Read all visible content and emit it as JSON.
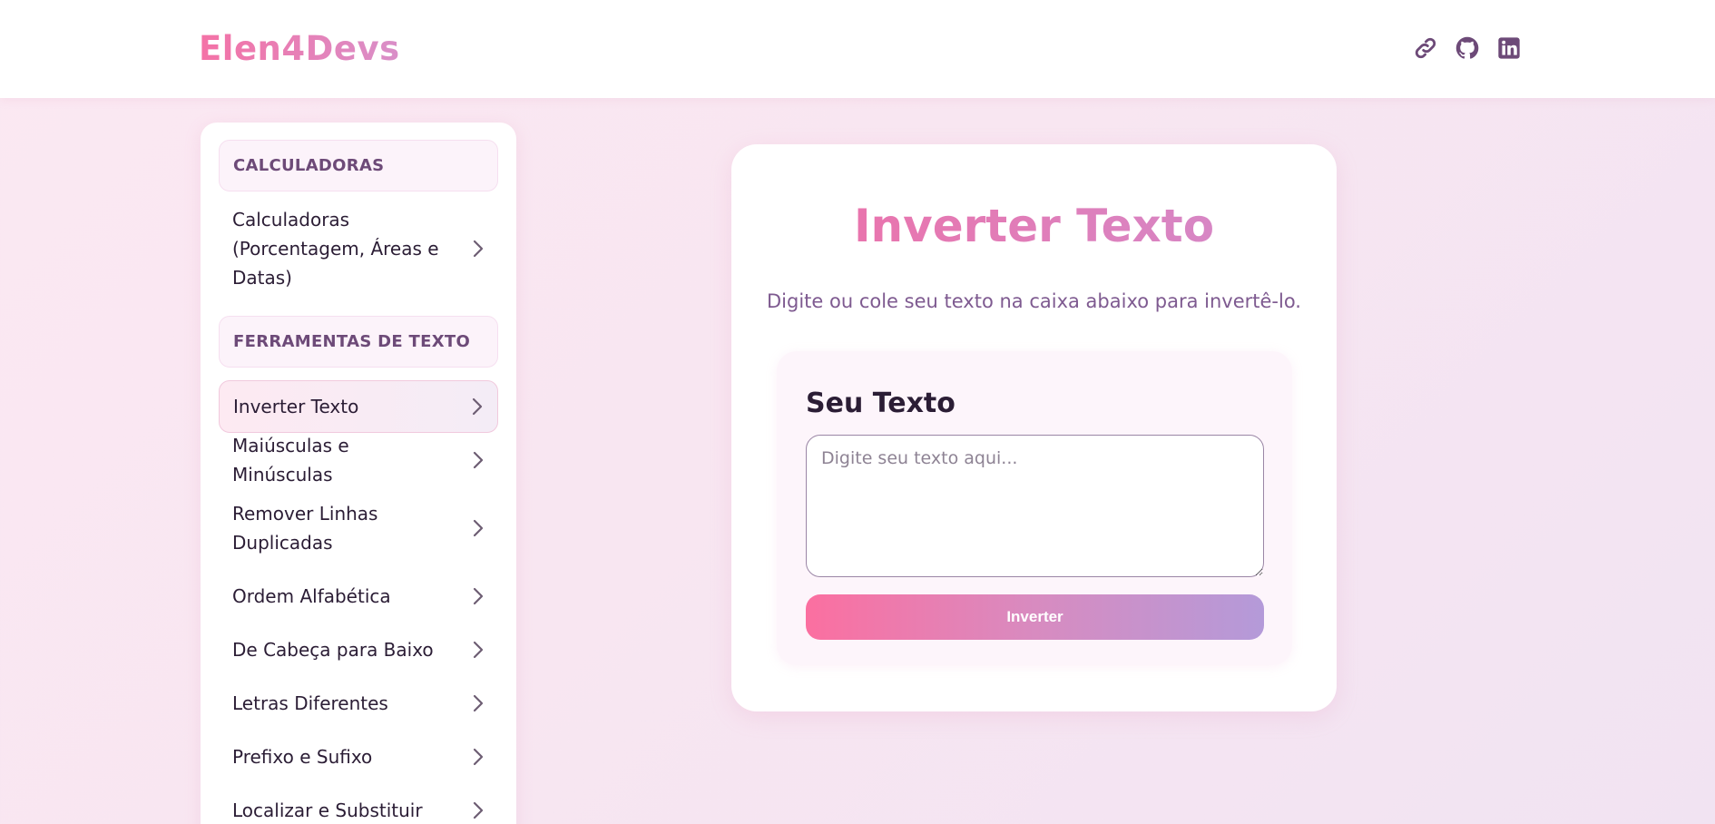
{
  "header": {
    "logo": "Elen4Devs",
    "icons": [
      "link-icon",
      "github-icon",
      "linkedin-icon"
    ]
  },
  "sidebar": {
    "sections": [
      {
        "title": "CALCULADORAS",
        "items": [
          {
            "label": "Calculadoras (Porcentagem, Áreas e Datas)",
            "active": false
          }
        ]
      },
      {
        "title": "FERRAMENTAS DE TEXTO",
        "items": [
          {
            "label": "Inverter Texto",
            "active": true
          },
          {
            "label": "Maiúsculas e Minúsculas",
            "active": false
          },
          {
            "label": "Remover Linhas Duplicadas",
            "active": false
          },
          {
            "label": "Ordem Alfabética",
            "active": false
          },
          {
            "label": "De Cabeça para Baixo",
            "active": false
          },
          {
            "label": "Letras Diferentes",
            "active": false
          },
          {
            "label": "Prefixo e Sufixo",
            "active": false
          },
          {
            "label": "Localizar e Substituir",
            "active": false
          }
        ]
      }
    ]
  },
  "main": {
    "title": "Inverter Texto",
    "subtitle": "Digite ou cole seu texto na caixa abaixo para invertê-lo.",
    "panel_title": "Seu Texto",
    "textarea_placeholder": "Digite seu texto aqui...",
    "textarea_value": "",
    "button_label": "Inverter"
  },
  "colors": {
    "brand_pink": "#f472a6",
    "brand_purple": "#b49ad9",
    "text_dark": "#2b1d35",
    "section_text": "#6d4a78"
  }
}
